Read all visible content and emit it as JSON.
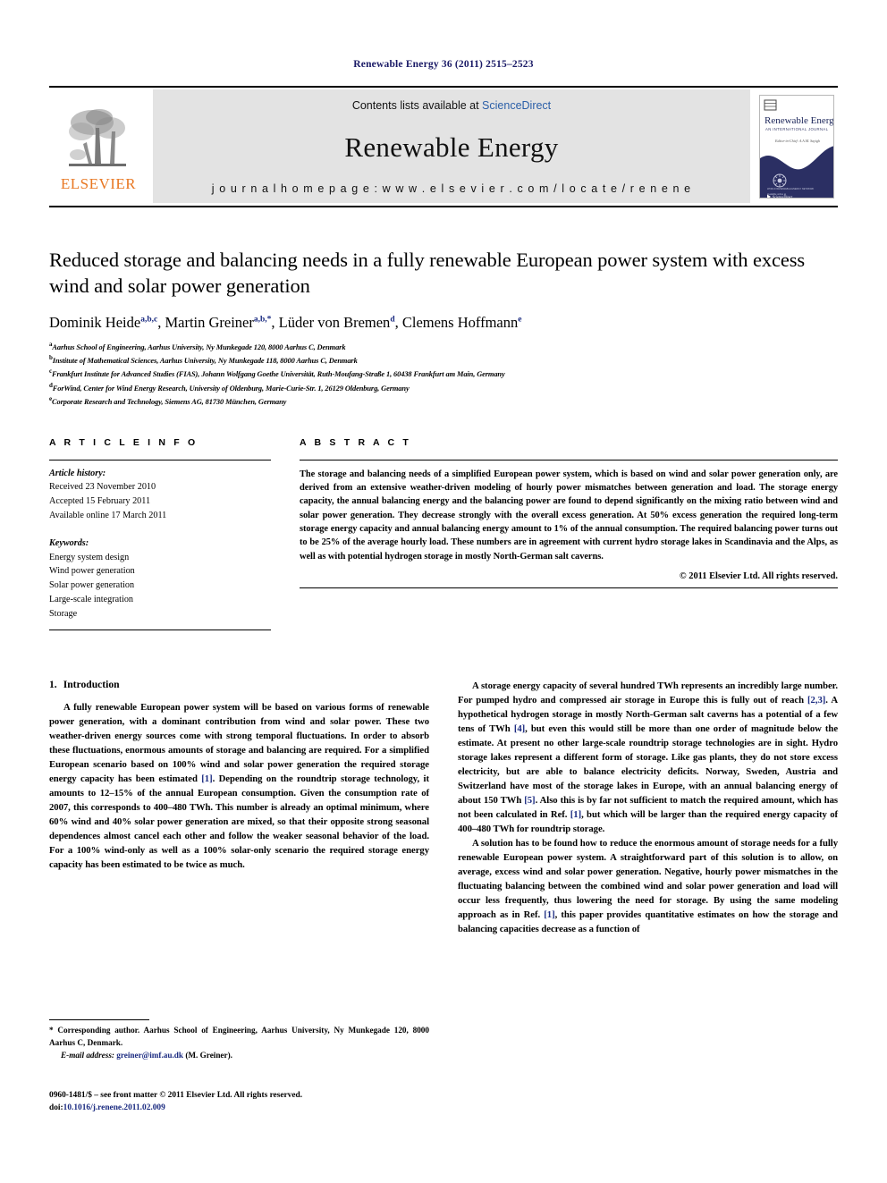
{
  "running_head": "Renewable Energy 36 (2011) 2515–2523",
  "banner": {
    "publisher_name": "ELSEVIER",
    "contents_prefix": "Contents lists available at ",
    "contents_link": "ScienceDirect",
    "journal_title": "Renewable Energy",
    "homepage": "j o u r n a l   h o m e p a g e :   w w w . e l s e v i e r . c o m / l o c a t e / r e n e n e",
    "cover_title": "Renewable Energy",
    "cover_subtitle": "AN INTERNATIONAL JOURNAL",
    "cover_editor": "Editor-in-Chief:  A.A.M. Sayigh",
    "cover_footer": "Available online at",
    "cover_footer2": "ScienceDirect"
  },
  "article": {
    "title": "Reduced storage and balancing needs in a fully renewable European power system with excess wind and solar power generation",
    "authors": [
      {
        "name": "Dominik Heide",
        "sup": "a,b,c"
      },
      {
        "name": "Martin Greiner",
        "sup": "a,b,*"
      },
      {
        "name": "Lüder von Bremen",
        "sup": "d"
      },
      {
        "name": "Clemens Hoffmann",
        "sup": "e"
      }
    ],
    "affiliations": [
      {
        "mark": "a",
        "text": "Aarhus School of Engineering, Aarhus University, Ny Munkegade 120, 8000 Aarhus C, Denmark"
      },
      {
        "mark": "b",
        "text": "Institute of Mathematical Sciences, Aarhus University, Ny Munkegade 118, 8000 Aarhus C, Denmark"
      },
      {
        "mark": "c",
        "text": "Frankfurt Institute for Advanced Studies (FIAS), Johann Wolfgang Goethe Universität, Ruth-Moufang-Straße 1, 60438 Frankfurt am Main, Germany"
      },
      {
        "mark": "d",
        "text": "ForWind, Center for Wind Energy Research, University of Oldenburg, Marie-Curie-Str. 1, 26129 Oldenburg, Germany"
      },
      {
        "mark": "e",
        "text": "Corporate Research and Technology, Siemens AG, 81730 München, Germany"
      }
    ]
  },
  "article_info": {
    "heading": "A R T I C L E  I N F O",
    "history_label": "Article history:",
    "history": [
      "Received 23 November 2010",
      "Accepted 15 February 2011",
      "Available online 17 March 2011"
    ],
    "keywords_label": "Keywords:",
    "keywords": [
      "Energy system design",
      "Wind power generation",
      "Solar power generation",
      "Large-scale integration",
      "Storage"
    ]
  },
  "abstract": {
    "heading": "A B S T R A C T",
    "text": "The storage and balancing needs of a simplified European power system, which is based on wind and solar power generation only, are derived from an extensive weather-driven modeling of hourly power mismatches between generation and load. The storage energy capacity, the annual balancing energy and the balancing power are found to depend significantly on the mixing ratio between wind and solar power generation. They decrease strongly with the overall excess generation. At 50% excess generation the required long-term storage energy capacity and annual balancing energy amount to 1% of the annual consumption. The required balancing power turns out to be 25% of the average hourly load. These numbers are in agreement with current hydro storage lakes in Scandinavia and the Alps, as well as with potential hydrogen storage in mostly North-German salt caverns.",
    "copyright": "© 2011 Elsevier Ltd. All rights reserved."
  },
  "introduction": {
    "number": "1.",
    "heading": "Introduction",
    "paragraph_1_a": "A fully renewable European power system will be based on various forms of renewable power generation, with a dominant contribution from wind and solar power. These two weather-driven energy sources come with strong temporal fluctuations. In order to absorb these fluctuations, enormous amounts of storage and balancing are required. For a simplified European scenario based on 100% wind and solar power generation the required storage energy capacity has been estimated ",
    "ref_1": "[1]",
    "paragraph_1_b": ". Depending on the roundtrip storage technology, it amounts to 12–15% of the annual European consumption. Given the consumption rate of 2007, this corresponds to 400–480 TWh. This number is already an optimal minimum, where 60% wind and 40% solar power generation are mixed, so that their opposite strong seasonal dependences almost cancel each other and follow the weaker seasonal behavior of the load. For a 100% wind-only as well as a 100% solar-only scenario the required storage energy capacity has been estimated to be twice as much."
  },
  "right_column": {
    "paragraph_2_a": "A storage energy capacity of several hundred TWh represents an incredibly large number. For pumped hydro and compressed air storage in Europe this is fully out of reach ",
    "ref_23": "[2,3]",
    "paragraph_2_b": ". A hypothetical hydrogen storage in mostly North-German salt caverns has a potential of a few tens of TWh ",
    "ref_4": "[4]",
    "paragraph_2_c": ", but even this would still be more than one order of magnitude below the estimate. At present no other large-scale roundtrip storage technologies are in sight. Hydro storage lakes represent a different form of storage. Like gas plants, they do not store excess electricity, but are able to balance electricity deficits. Norway, Sweden, Austria and Switzerland have most of the storage lakes in Europe, with an annual balancing energy of about 150 TWh ",
    "ref_5": "[5]",
    "paragraph_2_d": ". Also this is by far not sufficient to match the required amount, which has not been calculated in Ref. ",
    "ref_1b": "[1]",
    "paragraph_2_e": ", but which will be larger than the required energy capacity of 400–480 TWh for roundtrip storage.",
    "paragraph_3_a": "A solution has to be found how to reduce the enormous amount of storage needs for a fully renewable European power system. A straightforward part of this solution is to allow, on average, excess wind and solar power generation. Negative, hourly power mismatches in the fluctuating balancing between the combined wind and solar power generation and load will occur less frequently, thus lowering the need for storage. By using the same modeling approach as in Ref. ",
    "ref_1c": "[1]",
    "paragraph_3_b": ", this paper provides quantitative estimates on how the storage and balancing capacities decrease as a function of"
  },
  "footnote": {
    "corresponding": "* Corresponding author. Aarhus School of Engineering, Aarhus University, Ny Munkegade 120, 8000 Aarhus C, Denmark.",
    "email_label": "E-mail address:",
    "email": "greiner@imf.au.dk",
    "email_owner": "(M. Greiner)."
  },
  "imprint": {
    "issn_line": "0960-1481/$ – see front matter © 2011 Elsevier Ltd. All rights reserved.",
    "doi_label": "doi:",
    "doi": "10.1016/j.renene.2011.02.009"
  },
  "colors": {
    "link_blue": "#1a2a80",
    "sciencedirect_blue": "#2b5fa8",
    "elsevier_orange": "#E87722",
    "banner_grey": "#e3e3e3"
  }
}
